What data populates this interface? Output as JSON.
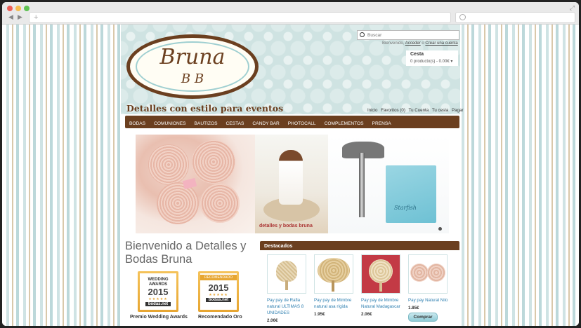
{
  "browser": {
    "back_icon": "◀",
    "forward_icon": "▶",
    "new_tab_icon": "+",
    "expand_icon": "⤢"
  },
  "header": {
    "logo_text": "Bruna",
    "logo_monogram": "B B",
    "tagline": "Detalles con estilo para eventos",
    "search_placeholder": "Buscar",
    "welcome_prefix": "Bienvenido,",
    "login_link": "Acceder",
    "separator": "o",
    "register_link": "Crear una cuenta",
    "cart_title": "Cesta",
    "cart_summary": "0 producto(s) - 0.00€",
    "top_links": [
      "Inicio",
      "Favoritos (0)",
      "Tu Cuenta",
      "Tu cesta",
      "Pagar"
    ]
  },
  "menu": [
    "BODAS",
    "COMUNIONES",
    "BAUTIZOS",
    "CESTAS",
    "CANDY BAR",
    "PHOTOCALL",
    "COMPLEMENTOS",
    "PRENSA"
  ],
  "banner": {
    "caption": "detalles y bodas bruna",
    "box_label": "Starfish"
  },
  "main": {
    "welcome_title": "Bienvenido a Detalles y Bodas Bruna",
    "awards": [
      {
        "ribbon": "",
        "line1": "WEDDING",
        "line2": "AWARDS",
        "year": "2015",
        "brand": "bodas.net",
        "caption": "Premio Wedding Awards"
      },
      {
        "ribbon": "RECOMENDADO",
        "line1": "",
        "line2": "",
        "year": "2015",
        "brand": "bodas.net",
        "caption": "Recomendado Oro"
      }
    ]
  },
  "featured": {
    "title": "Destacados",
    "products": [
      {
        "name": "Pay pay de Rafia natural ULTIMAS 8 UNIDADES",
        "price": "2.06€",
        "button": ""
      },
      {
        "name": "Pay pay de Mimbre natural asa rígida",
        "price": "1.95€",
        "button": ""
      },
      {
        "name": "Pay pay de Mimbre Natural Madagascar",
        "price": "2.06€",
        "button": ""
      },
      {
        "name": "Pay pay Natural Nilo",
        "price": "1.85€",
        "button": "Comprar"
      }
    ]
  },
  "colors": {
    "brand_brown": "#6b3f1f",
    "accent_blue": "#2e7fb0",
    "header_bg": "#cfe3e2"
  }
}
